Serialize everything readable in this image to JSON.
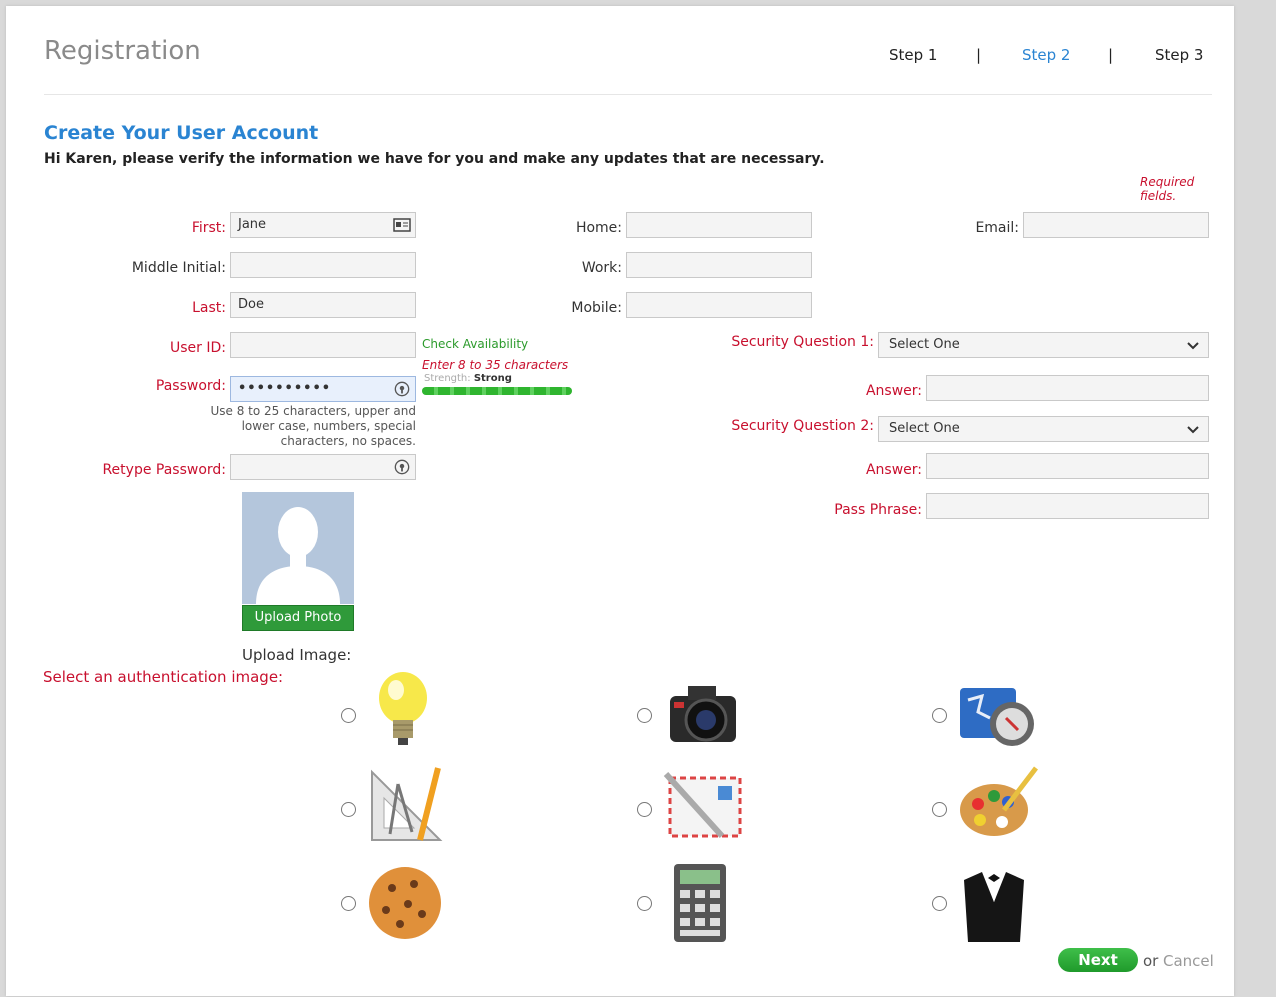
{
  "header": {
    "title": "Registration",
    "steps": [
      "Step 1",
      "Step 2",
      "Step 3"
    ],
    "separator": "|",
    "active_step": "Step 2"
  },
  "section": {
    "title": "Create Your User Account",
    "intro": "Hi Karen, please verify the information we have for you and make any updates that are necessary.",
    "required_note": "Required fields."
  },
  "form": {
    "first": {
      "label": "First:",
      "value": "Jane"
    },
    "middle": {
      "label": "Middle Initial:",
      "value": ""
    },
    "last": {
      "label": "Last:",
      "value": "Doe"
    },
    "user_id": {
      "label": "User ID:",
      "value": "",
      "check_link": "Check Availability",
      "hint": "Enter 8 to 35 characters"
    },
    "password": {
      "label": "Password:",
      "value": "••••••••••",
      "strength_label": "Strength:",
      "strength_value": "Strong",
      "strength_level": 1.0,
      "help": [
        "Use 8 to 25 characters, upper and",
        "lower case, numbers, special",
        "characters, no spaces."
      ]
    },
    "retype": {
      "label": "Retype Password:",
      "value": ""
    },
    "home": {
      "label": "Home:",
      "value": ""
    },
    "work": {
      "label": "Work:",
      "value": ""
    },
    "mobile": {
      "label": "Mobile:",
      "value": ""
    },
    "email": {
      "label": "Email:",
      "value": ""
    },
    "sq1": {
      "label": "Security Question 1:",
      "value": "Select One"
    },
    "answer1": {
      "label": "Answer:",
      "value": ""
    },
    "sq2": {
      "label": "Security Question 2:",
      "value": "Select One"
    },
    "answer2": {
      "label": "Answer:",
      "value": ""
    },
    "pass_phrase": {
      "label": "Pass Phrase:",
      "value": ""
    }
  },
  "photo": {
    "button": "Upload Photo",
    "upload_label": "Upload Image:"
  },
  "auth": {
    "label": "Select an authentication image:",
    "options": [
      "lightbulb",
      "camera",
      "map-compass",
      "drafting-tools",
      "mail-pen",
      "paint-palette",
      "cookie",
      "calculator",
      "tuxedo"
    ]
  },
  "footer": {
    "next": "Next",
    "or": "or",
    "cancel": "Cancel"
  },
  "colors": {
    "required": "#c8102e",
    "link": "#2a84d2",
    "success": "#2b9a2b"
  }
}
